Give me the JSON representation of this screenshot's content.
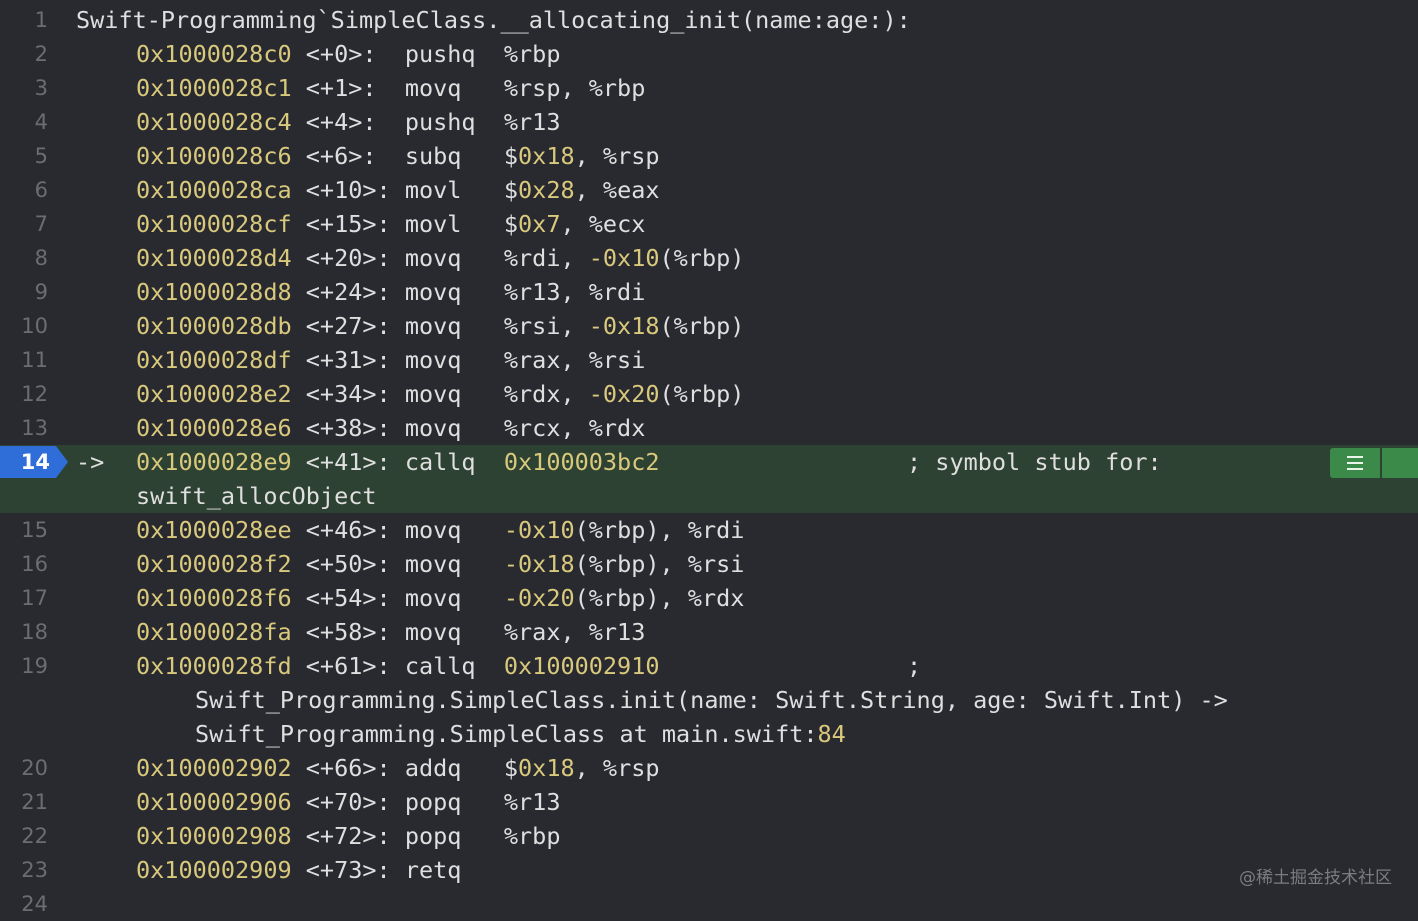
{
  "function_header": "Swift-Programming`SimpleClass.__allocating_init(name:age:):",
  "line_numbers": [
    "1",
    "2",
    "3",
    "4",
    "5",
    "6",
    "7",
    "8",
    "9",
    "10",
    "11",
    "12",
    "13",
    "14",
    "15",
    "16",
    "17",
    "18",
    "19",
    "20",
    "21",
    "22",
    "23",
    "24"
  ],
  "pc_arrow": "->",
  "instructions": [
    {
      "address": "0x1000028c0",
      "offset": "<+0>:",
      "pad": "  ",
      "mnemonic": "pushq",
      "operands": [
        {
          "t": "%rbp",
          "c": "p"
        }
      ]
    },
    {
      "address": "0x1000028c1",
      "offset": "<+1>:",
      "pad": "  ",
      "mnemonic": "movq",
      "operands": [
        {
          "t": "%rsp, %rbp",
          "c": "p"
        }
      ]
    },
    {
      "address": "0x1000028c4",
      "offset": "<+4>:",
      "pad": "  ",
      "mnemonic": "pushq",
      "operands": [
        {
          "t": "%r13",
          "c": "p"
        }
      ]
    },
    {
      "address": "0x1000028c6",
      "offset": "<+6>:",
      "pad": "  ",
      "mnemonic": "subq",
      "operands": [
        {
          "t": "$",
          "c": "p"
        },
        {
          "t": "0x18",
          "c": "h"
        },
        {
          "t": ", %rsp",
          "c": "p"
        }
      ]
    },
    {
      "address": "0x1000028ca",
      "offset": "<+10>:",
      "pad": " ",
      "mnemonic": "movl",
      "operands": [
        {
          "t": "$",
          "c": "p"
        },
        {
          "t": "0x28",
          "c": "h"
        },
        {
          "t": ", %eax",
          "c": "p"
        }
      ]
    },
    {
      "address": "0x1000028cf",
      "offset": "<+15>:",
      "pad": " ",
      "mnemonic": "movl",
      "operands": [
        {
          "t": "$",
          "c": "p"
        },
        {
          "t": "0x7",
          "c": "h"
        },
        {
          "t": ", %ecx",
          "c": "p"
        }
      ]
    },
    {
      "address": "0x1000028d4",
      "offset": "<+20>:",
      "pad": " ",
      "mnemonic": "movq",
      "operands": [
        {
          "t": "%rdi, ",
          "c": "p"
        },
        {
          "t": "-0x10",
          "c": "h"
        },
        {
          "t": "(%rbp)",
          "c": "p"
        }
      ]
    },
    {
      "address": "0x1000028d8",
      "offset": "<+24>:",
      "pad": " ",
      "mnemonic": "movq",
      "operands": [
        {
          "t": "%r13, %rdi",
          "c": "p"
        }
      ]
    },
    {
      "address": "0x1000028db",
      "offset": "<+27>:",
      "pad": " ",
      "mnemonic": "movq",
      "operands": [
        {
          "t": "%rsi, ",
          "c": "p"
        },
        {
          "t": "-0x18",
          "c": "h"
        },
        {
          "t": "(%rbp)",
          "c": "p"
        }
      ]
    },
    {
      "address": "0x1000028df",
      "offset": "<+31>:",
      "pad": " ",
      "mnemonic": "movq",
      "operands": [
        {
          "t": "%rax, %rsi",
          "c": "p"
        }
      ]
    },
    {
      "address": "0x1000028e2",
      "offset": "<+34>:",
      "pad": " ",
      "mnemonic": "movq",
      "operands": [
        {
          "t": "%rdx, ",
          "c": "p"
        },
        {
          "t": "-0x20",
          "c": "h"
        },
        {
          "t": "(%rbp)",
          "c": "p"
        }
      ]
    },
    {
      "address": "0x1000028e6",
      "offset": "<+38>:",
      "pad": " ",
      "mnemonic": "movq",
      "operands": [
        {
          "t": "%rcx, %rdx",
          "c": "p"
        }
      ]
    },
    {
      "address": "0x1000028e9",
      "offset": "<+41>:",
      "pad": " ",
      "mnemonic": "callq",
      "operands": [
        {
          "t": "0x100003bc2",
          "c": "h"
        }
      ],
      "comment": "; symbol stub for:",
      "wrap": [
        "swift_allocObject"
      ],
      "current": true
    },
    {
      "address": "0x1000028ee",
      "offset": "<+46>:",
      "pad": " ",
      "mnemonic": "movq",
      "operands": [
        {
          "t": "-0x10",
          "c": "h"
        },
        {
          "t": "(%rbp), %rdi",
          "c": "p"
        }
      ]
    },
    {
      "address": "0x1000028f2",
      "offset": "<+50>:",
      "pad": " ",
      "mnemonic": "movq",
      "operands": [
        {
          "t": "-0x18",
          "c": "h"
        },
        {
          "t": "(%rbp), %rsi",
          "c": "p"
        }
      ]
    },
    {
      "address": "0x1000028f6",
      "offset": "<+54>:",
      "pad": " ",
      "mnemonic": "movq",
      "operands": [
        {
          "t": "-0x20",
          "c": "h"
        },
        {
          "t": "(%rbp), %rdx",
          "c": "p"
        }
      ]
    },
    {
      "address": "0x1000028fa",
      "offset": "<+58>:",
      "pad": " ",
      "mnemonic": "movq",
      "operands": [
        {
          "t": "%rax, %r13",
          "c": "p"
        }
      ]
    },
    {
      "address": "0x1000028fd",
      "offset": "<+61>:",
      "pad": " ",
      "mnemonic": "callq",
      "operands": [
        {
          "t": "0x100002910",
          "c": "h"
        }
      ],
      "comment": ";",
      "wrap2": [
        [
          {
            "t": "Swift_Programming.SimpleClass.init(name: Swift.String, age: Swift.Int) ->",
            "c": "p"
          }
        ],
        [
          {
            "t": "Swift_Programming.SimpleClass at main.swift:",
            "c": "p"
          },
          {
            "t": "84",
            "c": "h"
          }
        ]
      ]
    },
    {
      "address": "0x100002902",
      "offset": "<+66>:",
      "pad": " ",
      "mnemonic": "addq",
      "operands": [
        {
          "t": "$",
          "c": "p"
        },
        {
          "t": "0x18",
          "c": "h"
        },
        {
          "t": ", %rsp",
          "c": "p"
        }
      ]
    },
    {
      "address": "0x100002906",
      "offset": "<+70>:",
      "pad": " ",
      "mnemonic": "popq",
      "operands": [
        {
          "t": "%r13",
          "c": "p"
        }
      ]
    },
    {
      "address": "0x100002908",
      "offset": "<+72>:",
      "pad": " ",
      "mnemonic": "popq",
      "operands": [
        {
          "t": "%rbp",
          "c": "p"
        }
      ]
    },
    {
      "address": "0x100002909",
      "offset": "<+73>:",
      "pad": " ",
      "mnemonic": "retq",
      "operands": []
    }
  ],
  "watermark": "@稀土掘金技术社区",
  "colors": {
    "background": "#292a30",
    "current_line": "#2d4232",
    "pc_marker": "#2f6ed8",
    "hex": "#d9c97c",
    "plain": "#dfdfe0",
    "line_number": "#6c6c72",
    "action_button": "#3c8a4a"
  }
}
